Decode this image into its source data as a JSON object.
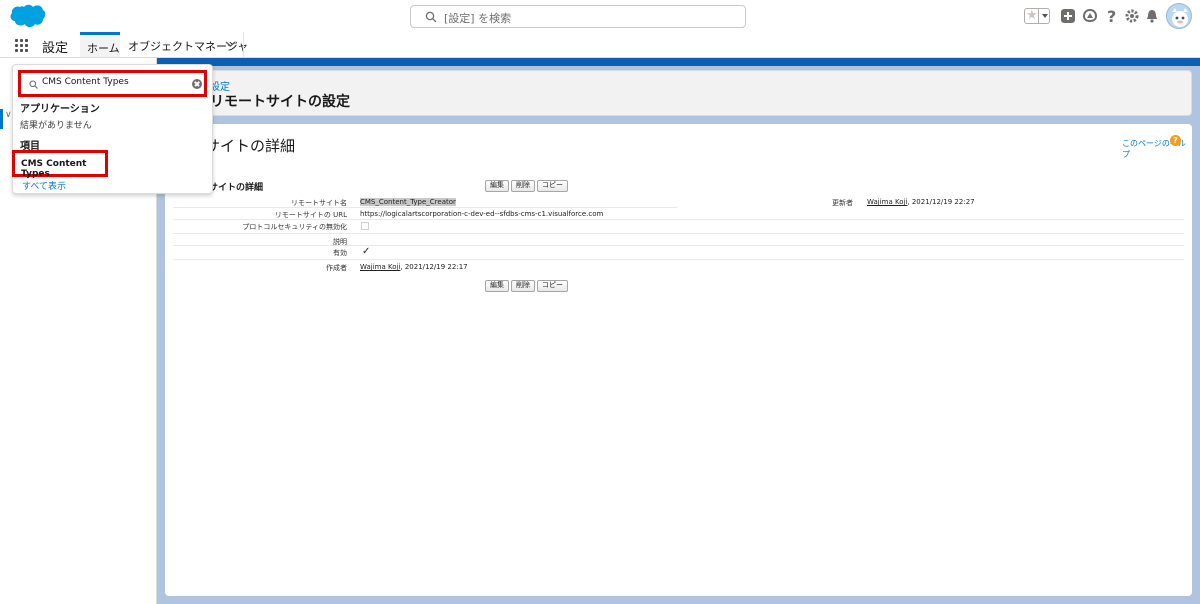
{
  "global_header": {
    "search_placeholder": "[設定] を検索",
    "icons": [
      "salesforce-logo",
      "favorites-star-icon",
      "add-icon",
      "trailhead-icon",
      "help-icon",
      "gear-icon",
      "bell-icon",
      "user-avatar"
    ]
  },
  "nav": {
    "app_name": "設定",
    "tabs": [
      {
        "label": "ホーム",
        "active": true
      },
      {
        "label": "オブジェクトマネージャ",
        "has_dropdown": true
      }
    ]
  },
  "quick_find": {
    "input_value": "CMS Content Types",
    "group_apps": "アプリケーション",
    "no_results": "結果がありません",
    "group_items": "項目",
    "result_item": "CMS Content Types",
    "show_all": "すべて表示"
  },
  "page_header": {
    "breadcrumb": "設定",
    "title": "リモートサイトの設定"
  },
  "detail": {
    "card_title": "サイトの詳細",
    "help_link": "このページのヘルプ",
    "section_title": "サイトの詳細",
    "buttons": [
      "編集",
      "削除",
      "コピー"
    ],
    "fields": {
      "remote_site_name_label": "リモートサイト名",
      "remote_site_name_value": "CMS_Content_Type_Creator",
      "remote_site_url_label": "リモートサイトの URL",
      "remote_site_url_value": "https://logicalartscorporation-c-dev-ed--sfdbs-cms-c1.visualforce.com",
      "disable_protocol_security_label": "プロトコルセキュリティの無効化",
      "disable_protocol_security_value": false,
      "description_label": "説明",
      "active_label": "有効",
      "active_value": true,
      "active_check": "✓",
      "created_by_label": "作成者",
      "created_by_user": "Wajima Koji",
      "created_by_date": ", 2021/12/19 22:17",
      "modified_by_label": "更新者",
      "modified_by_user": "Wajima Koji",
      "modified_by_date": ", 2021/12/19 22:27"
    }
  },
  "colors": {
    "brand_blue": "#0176d3",
    "highlight_red": "#e00000",
    "content_background": "#b0c4df"
  }
}
